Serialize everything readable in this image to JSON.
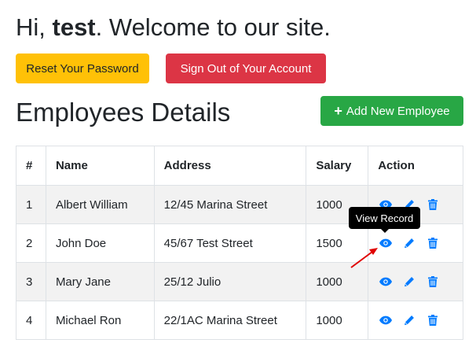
{
  "greeting": {
    "prefix": "Hi, ",
    "username": "test",
    "suffix": ". Welcome to our site."
  },
  "account_buttons": {
    "reset_password": "Reset Your Password",
    "sign_out": "Sign Out of Your Account"
  },
  "section": {
    "title": "Employees Details",
    "add_button": "Add New Employee",
    "add_icon": "plus-icon"
  },
  "table": {
    "headers": [
      "#",
      "Name",
      "Address",
      "Salary",
      "Action"
    ],
    "rows": [
      {
        "id": "1",
        "name": "Albert William",
        "address": "12/45 Marina Street",
        "salary": "1000"
      },
      {
        "id": "2",
        "name": "John Doe",
        "address": "45/67 Test Street",
        "salary": "1500"
      },
      {
        "id": "3",
        "name": "Mary Jane",
        "address": "25/12 Julio",
        "salary": "1000"
      },
      {
        "id": "4",
        "name": "Michael Ron",
        "address": "22/1AC Marina Street",
        "salary": "1000"
      }
    ],
    "action_icons": [
      "eye-icon",
      "pencil-icon",
      "trash-icon"
    ]
  },
  "tooltip": {
    "text": "View Record"
  },
  "colors": {
    "warning": "#ffc107",
    "danger": "#dc3545",
    "success": "#28a745",
    "action_icon": "#007bff",
    "annotation_arrow": "#e00000"
  }
}
